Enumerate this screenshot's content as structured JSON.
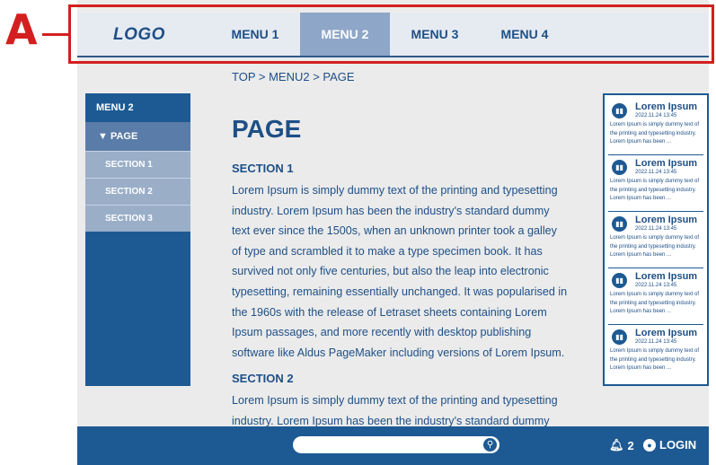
{
  "annotation": {
    "label": "A"
  },
  "header": {
    "logo": "LOGO",
    "nav": [
      {
        "label": "MENU 1"
      },
      {
        "label": "MENU 2"
      },
      {
        "label": "MENU 3"
      },
      {
        "label": "MENU 4"
      }
    ]
  },
  "breadcrumb": "TOP > MENU2 > PAGE",
  "sidebar": {
    "heading": "MENU 2",
    "page": "▼ PAGE",
    "sections": [
      {
        "label": "SECTION 1"
      },
      {
        "label": "SECTION 2"
      },
      {
        "label": "SECTION 3"
      }
    ]
  },
  "main": {
    "title": "PAGE",
    "sections": [
      {
        "heading": "SECTION 1",
        "text": "Lorem Ipsum is simply dummy text of the printing and typesetting industry. Lorem Ipsum has been the industry's standard dummy text ever since the 1500s, when an unknown printer took a galley of type and scrambled it to make a type specimen book. It has survived not only five centuries, but also the leap into electronic typesetting, remaining essentially unchanged. It was popularised in the 1960s with the release of Letraset sheets containing Lorem Ipsum passages, and more recently with desktop publishing software like Aldus PageMaker including versions of Lorem Ipsum."
      },
      {
        "heading": "SECTION 2",
        "text": "Lorem Ipsum is simply dummy text of the printing and typesetting industry. Lorem Ipsum has been the industry's standard dummy"
      }
    ]
  },
  "news": {
    "items": [
      {
        "title": "Lorem Ipsum",
        "date": "2022.11.24 13:45",
        "body": "Lorem Ipsum is simply dummy text of the printing and typesetting industry. Lorem Ipsum has been ..."
      },
      {
        "title": "Lorem Ipsum",
        "date": "2022.11.24 13:45",
        "body": "Lorem Ipsum is simply dummy text of the printing and typesetting industry. Lorem Ipsum has been ..."
      },
      {
        "title": "Lorem Ipsum",
        "date": "2022.11.24 13:45",
        "body": "Lorem Ipsum is simply dummy text of the printing and typesetting industry. Lorem Ipsum has been ..."
      },
      {
        "title": "Lorem Ipsum",
        "date": "2022.11.24 13:45",
        "body": "Lorem Ipsum is simply dummy text of the printing and typesetting industry. Lorem Ipsum has been ..."
      },
      {
        "title": "Lorem Ipsum",
        "date": "2022.11.24 13:45",
        "body": "Lorem Ipsum is simply dummy text of the printing and typesetting industry. Lorem Ipsum has been ..."
      }
    ]
  },
  "footer": {
    "notification_count": "2",
    "login_label": "LOGIN"
  },
  "colors": {
    "brand": "#1d5a93",
    "nav_active": "#8ea6c8",
    "annotation": "#d31f1f"
  },
  "icons": {
    "news": "book-icon",
    "search": "search-icon",
    "notification": "bell-icon",
    "user": "user-icon"
  }
}
